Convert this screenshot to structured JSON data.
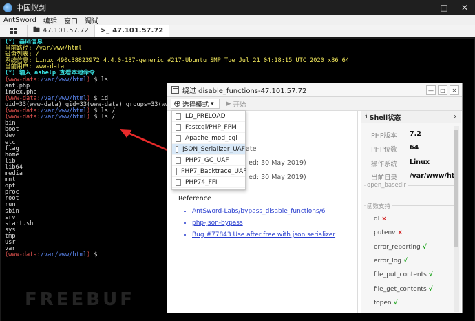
{
  "window": {
    "title": "中国蚁剑"
  },
  "menu": [
    "AntSword",
    "编辑",
    "窗口",
    "调试"
  ],
  "tabs": [
    {
      "label": "47.101.57.72",
      "icon": "folder-icon"
    },
    {
      "label": "47.101.57.72",
      "icon": "terminal-icon"
    }
  ],
  "terminal": {
    "lines": [
      {
        "text": "(*) 基础信息",
        "color": "cyan"
      },
      {
        "text": "当前路径: /var/www/html",
        "color": "yellow"
      },
      {
        "text": "磁盘列表: /",
        "color": "yellow"
      },
      {
        "text": "系统信息: Linux 490c38823972 4.4.0-187-generic #217-Ubuntu SMP Tue Jul 21 04:18:15 UTC 2020 x86_64",
        "color": "yellow"
      },
      {
        "text": "当前用户: www-data",
        "color": "yellow"
      },
      {
        "text": "(*) 输入 ashelp 查看本地命令",
        "color": "cyan"
      },
      {
        "text": "(www-data:/var/www/html) $ ls",
        "color": "prompt"
      },
      {
        "text": "ant.php",
        "color": "white"
      },
      {
        "text": "index.php",
        "color": "white"
      },
      {
        "text": "(www-data:/var/www/html) $ id",
        "color": "prompt"
      },
      {
        "text": "uid=33(www-data) gid=33(www-data) groups=33(www-d",
        "color": "white"
      },
      {
        "text": "(www-data:/var/www/html) $ ls /",
        "color": "prompt"
      },
      {
        "text": "(www-data:/var/www/html) $ ls /",
        "color": "prompt"
      },
      {
        "text": "bin",
        "color": "white"
      },
      {
        "text": "boot",
        "color": "white"
      },
      {
        "text": "dev",
        "color": "white"
      },
      {
        "text": "etc",
        "color": "white"
      },
      {
        "text": "flag",
        "color": "white"
      },
      {
        "text": "home",
        "color": "white"
      },
      {
        "text": "lib",
        "color": "white"
      },
      {
        "text": "lib64",
        "color": "white"
      },
      {
        "text": "media",
        "color": "white"
      },
      {
        "text": "mnt",
        "color": "white"
      },
      {
        "text": "opt",
        "color": "white"
      },
      {
        "text": "proc",
        "color": "white"
      },
      {
        "text": "root",
        "color": "white"
      },
      {
        "text": "run",
        "color": "white"
      },
      {
        "text": "sbin",
        "color": "white"
      },
      {
        "text": "srv",
        "color": "white"
      },
      {
        "text": "start.sh",
        "color": "white"
      },
      {
        "text": "sys",
        "color": "white"
      },
      {
        "text": "tmp",
        "color": "white"
      },
      {
        "text": "usr",
        "color": "white"
      },
      {
        "text": "var",
        "color": "white"
      },
      {
        "text": "(www-data:/var/www/html) $",
        "color": "prompt"
      }
    ]
  },
  "dialog": {
    "title": "绕过 disable_functions-47.101.57.72",
    "toolbar": {
      "mode_label": "选择模式",
      "start_label": "开始"
    },
    "dropdown": {
      "items": [
        "LD_PRELOAD",
        "Fastcgi/PHP_FPM",
        "Apache_mod_cgi",
        "JSON_Serializer_UAF",
        "PHP7_GC_UAF",
        "PHP7_Backtrace_UAF",
        "PHP74_FFI"
      ],
      "active_index": 3
    },
    "content": {
      "fragment1": "date",
      "fragment2": "ed: 30 May 2019)",
      "fragment3": "ed: 30 May 2019)",
      "reference_heading": "Reference",
      "references": [
        "AntSword-Labs/bypass_disable_functions/6",
        "php-json-bypass",
        "Bug #77843 Use after free with json serializer"
      ]
    },
    "shell_status": {
      "title": "Shell状态",
      "info": [
        {
          "key": "PHP版本",
          "value": "7.2"
        },
        {
          "key": "PHP位数",
          "value": "64"
        },
        {
          "key": "操作系统",
          "value": "Linux"
        },
        {
          "key": "当前目录",
          "value": "/var/www/htm"
        }
      ],
      "open_basedir_label": "open_basedir",
      "functions_label": "函数支持",
      "functions": [
        {
          "name": "dl",
          "supported": false
        },
        {
          "name": "putenv",
          "supported": false
        },
        {
          "name": "error_reporting",
          "supported": true
        },
        {
          "name": "error_log",
          "supported": true
        },
        {
          "name": "file_put_contents",
          "supported": true
        },
        {
          "name": "file_get_contents",
          "supported": true
        },
        {
          "name": "fopen",
          "supported": true
        }
      ]
    }
  },
  "watermark": "FREEBUF"
}
